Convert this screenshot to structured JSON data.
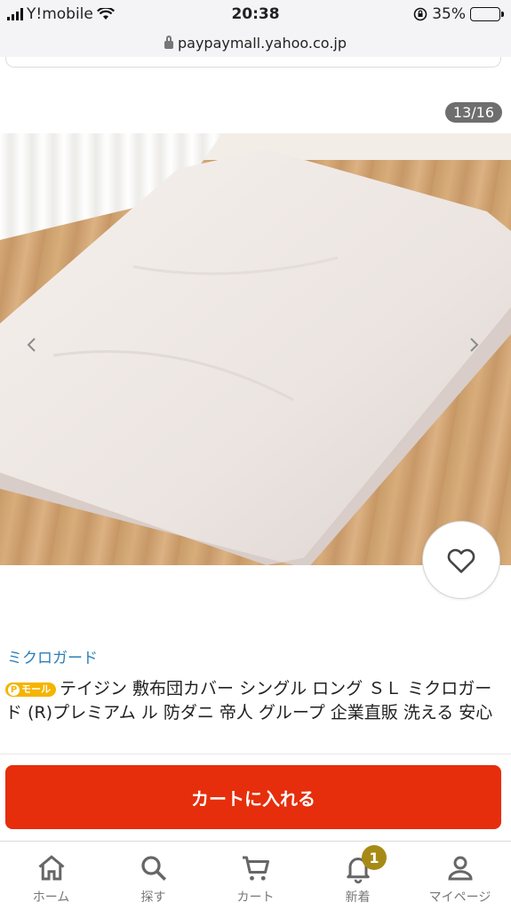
{
  "status_bar": {
    "carrier": "Y!mobile",
    "time": "20:38",
    "battery": "35%",
    "battery_level": 0.35
  },
  "browser": {
    "url": "paypaymall.yahoo.co.jp"
  },
  "gallery": {
    "counter": "13/16"
  },
  "product": {
    "brand": "ミクロガード",
    "badge": "モール",
    "title": "テイジン 敷布団カバー シングル ロング ＳＬ ミクロガード (R)プレミアム ル 防ダニ 帝人 グループ 企業直販 洗える 安心"
  },
  "actions": {
    "cart_button": "カートに入れる"
  },
  "tabbar": {
    "items": [
      {
        "label": "ホーム",
        "icon": "home-icon"
      },
      {
        "label": "探す",
        "icon": "search-icon"
      },
      {
        "label": "カート",
        "icon": "cart-icon"
      },
      {
        "label": "新着",
        "icon": "bell-icon",
        "badge": "1"
      },
      {
        "label": "マイページ",
        "icon": "person-icon"
      }
    ]
  },
  "colors": {
    "cart_button": "#e62e0c",
    "brand_link": "#2b7fb8",
    "badge": "#a78a16"
  }
}
